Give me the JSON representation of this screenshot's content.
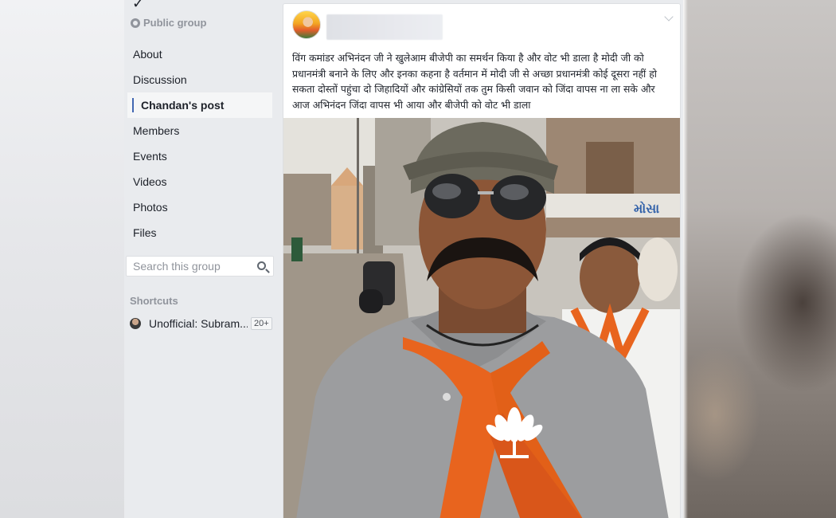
{
  "group": {
    "privacy_label": "Public group"
  },
  "sidebar": {
    "items": [
      {
        "label": "About",
        "active": false
      },
      {
        "label": "Discussion",
        "active": false
      },
      {
        "label": "Chandan's post",
        "active": true
      },
      {
        "label": "Members",
        "active": false
      },
      {
        "label": "Events",
        "active": false
      },
      {
        "label": "Videos",
        "active": false
      },
      {
        "label": "Photos",
        "active": false
      },
      {
        "label": "Files",
        "active": false
      }
    ],
    "search": {
      "placeholder": "Search this group"
    },
    "shortcuts": {
      "title": "Shortcuts",
      "items": [
        {
          "label": "Unofficial: Subram...",
          "badge": "20+"
        }
      ]
    }
  },
  "post": {
    "text": "विंग कमांडर अभिनंदन जी ने खुलेआम बीजेपी का समर्थन किया है और वोट भी डाला है मोदी जी को प्रधानमंत्री बनाने के लिए और इनका कहना है वर्तमान में मोदी जी से अच्छा प्रधानमंत्री कोई दूसरा नहीं हो सकता दोस्तों पहुंचा दो जिहादियों और कांग्रेसियों तक तुम किसी जवान को जिंदा वापस ना ला सके और आज अभिनंदन जिंदा वापस भी आया और बीजेपी को वोट भी डाला",
    "photo_sign_text": "મોસા"
  },
  "colors": {
    "accent": "#4267b2",
    "page_bg": "#e9ebee",
    "scarf_orange": "#e8641e",
    "muted_text": "#90949c"
  }
}
